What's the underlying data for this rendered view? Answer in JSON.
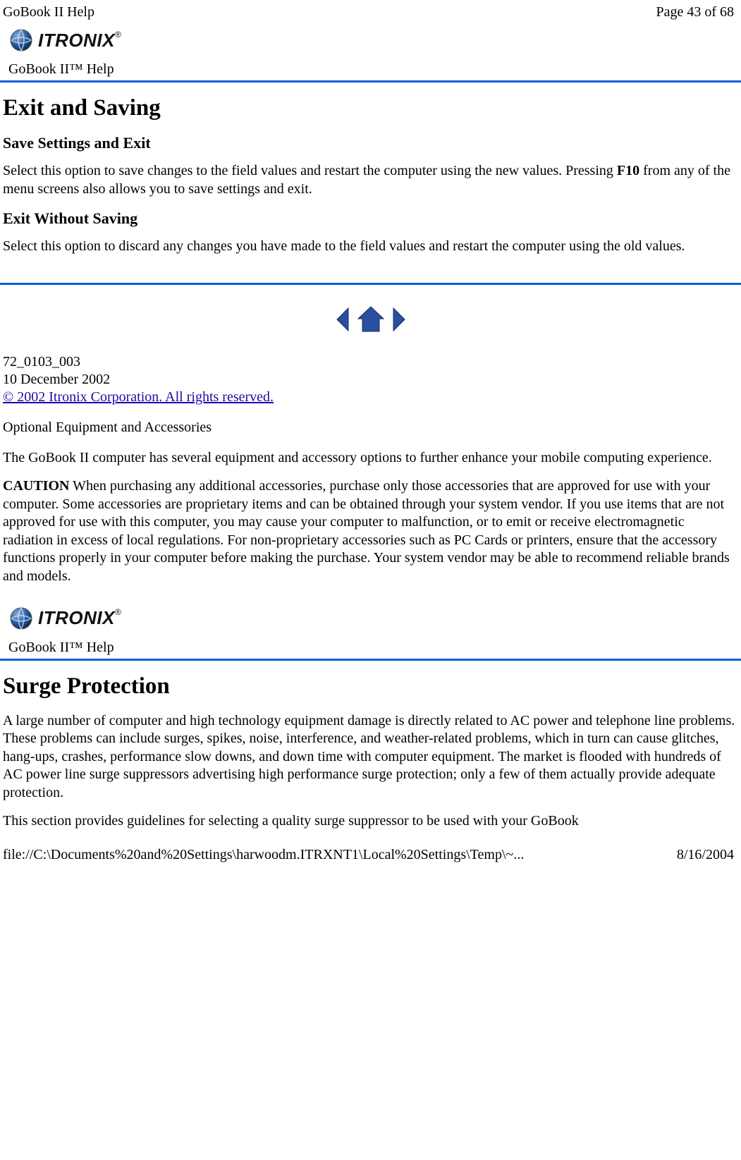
{
  "header": {
    "left": "GoBook II Help",
    "right": "Page 43 of 68"
  },
  "logo": {
    "brand": "ITRONIX",
    "reg": "®"
  },
  "help_label": "GoBook II™ Help",
  "section1": {
    "title": "Exit and Saving",
    "sub1": "Save Settings and Exit",
    "para1a": "Select this option to save changes to the field values and restart the computer using the new values.  Pressing ",
    "para1key": "F10",
    "para1b": " from any of the menu screens also allows you to save settings and exit.",
    "sub2": "Exit Without Saving",
    "para2": "Select this option to discard any changes you have made to the field values and restart the computer using the old values."
  },
  "meta": {
    "doc_id": "72_0103_003",
    "date": "10 December 2002",
    "copyright": "© 2002 Itronix Corporation.  All rights reserved."
  },
  "section2": {
    "heading": "Optional Equipment and Accessories",
    "intro": "The GoBook II computer has several equipment and accessory options to further enhance your mobile computing experience.",
    "caution_label": "CAUTION",
    "caution_text": "  When purchasing any additional accessories, purchase only those accessories that are approved for use with your computer. Some accessories are proprietary items and can be obtained through your system vendor. If you use items that are not approved for use with this computer, you may cause your computer to malfunction, or to emit or receive electromagnetic radiation in excess of local regulations. For non-proprietary accessories such as PC Cards or printers, ensure that the accessory functions properly in your computer before making the purchase. Your system vendor may be able to recommend reliable brands and models."
  },
  "section3": {
    "title": "Surge Protection",
    "para1": "A large number of computer and high technology equipment damage is directly related to AC power and telephone line problems. These problems can include surges, spikes, noise, interference, and weather-related problems, which in turn can cause glitches, hang-ups, crashes, performance slow downs, and down time with computer equipment. The market is flooded with hundreds of AC power line surge suppressors advertising high performance surge protection; only a few of them actually provide adequate protection.",
    "para2": "This section provides guidelines for selecting a quality surge suppressor to be used with your GoBook"
  },
  "footer": {
    "path": "file://C:\\Documents%20and%20Settings\\harwoodm.ITRXNT1\\Local%20Settings\\Temp\\~...",
    "date": "8/16/2004"
  }
}
